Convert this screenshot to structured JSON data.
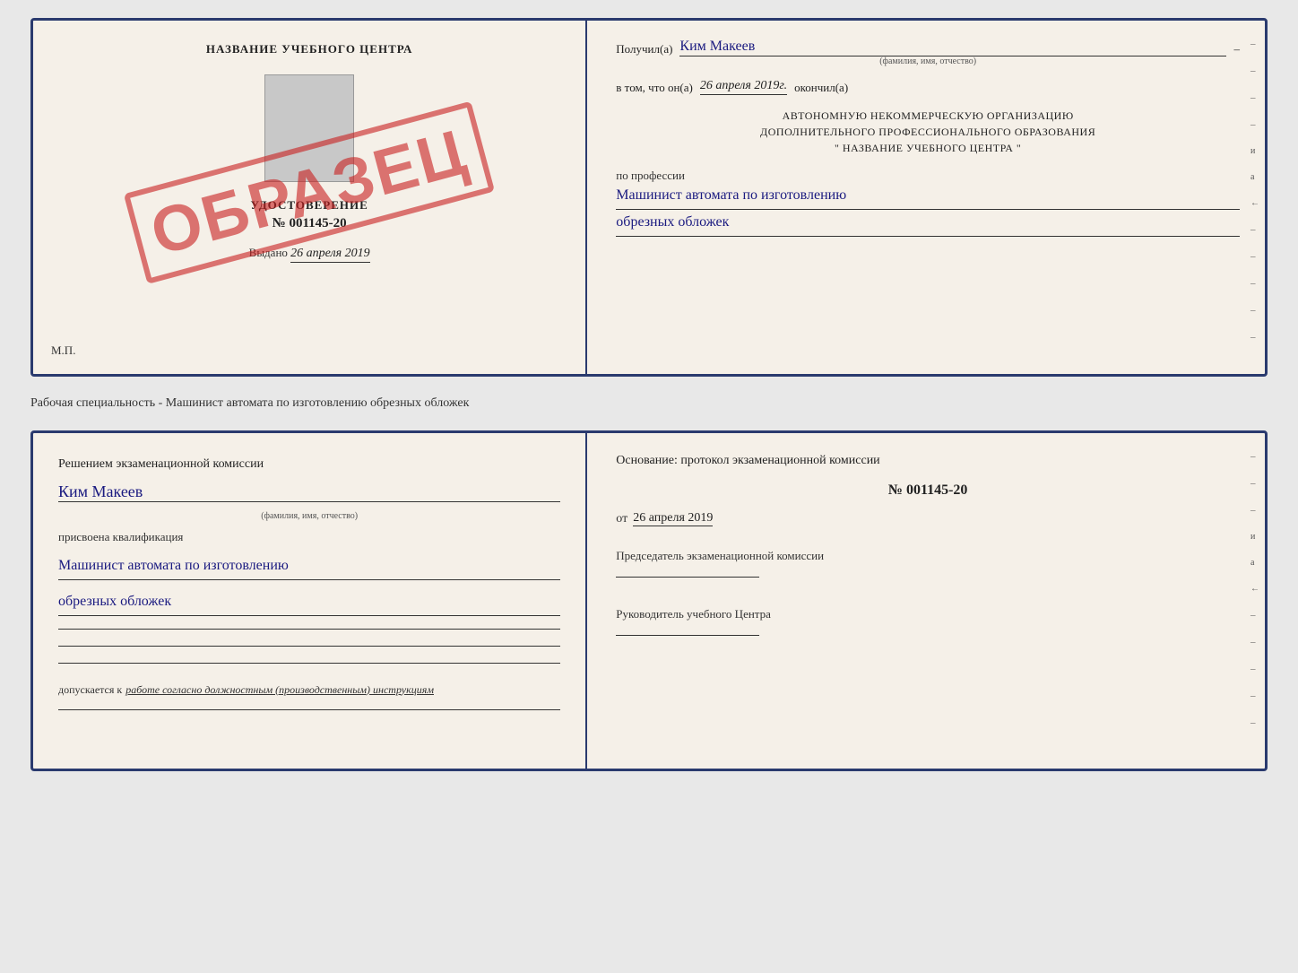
{
  "certificate": {
    "left": {
      "title": "НАЗВАНИЕ УЧЕБНОГО ЦЕНТРА",
      "stamp_text": "ОБРАЗЕЦ",
      "udost_label": "УДОСТОВЕРЕНИЕ",
      "cert_number": "№ 001145-20",
      "issued_label": "Выдано",
      "issued_date": "26 апреля 2019",
      "mp_label": "М.П."
    },
    "right": {
      "received_label": "Получил(а)",
      "received_name": "Ким Макеев",
      "received_subtext": "(фамилия, имя, отчество)",
      "date_label": "в том, что он(а)",
      "date_value": "26 апреля 2019г.",
      "finished_label": "окончил(а)",
      "org_line1": "АВТОНОМНУЮ НЕКОММЕРЧЕСКУЮ ОРГАНИЗАЦИЮ",
      "org_line2": "ДОПОЛНИТЕЛЬНОГО ПРОФЕССИОНАЛЬНОГО ОБРАЗОВАНИЯ",
      "org_line3": "\"  НАЗВАНИЕ УЧЕБНОГО ЦЕНТРА  \"",
      "profession_label": "по профессии",
      "profession_line1": "Машинист автомата по изготовлению",
      "profession_line2": "обрезных обложек",
      "side_dashes": [
        "–",
        "–",
        "–",
        "–",
        "–",
        "–"
      ]
    }
  },
  "separator": {
    "text": "Рабочая специальность - Машинист автомата по изготовлению обрезных обложек"
  },
  "qualification": {
    "left": {
      "decision_label": "Решением экзаменационной комиссии",
      "name": "Ким Макеев",
      "name_subtext": "(фамилия, имя, отчество)",
      "assigned_label": "присвоена квалификация",
      "qualification_line1": "Машинист автомата по изготовлению",
      "qualification_line2": "обрезных обложек",
      "line1": "",
      "line2": "",
      "line3": "",
      "permission_text": "допускается к",
      "permission_italic": "работе согласно должностным (производственным) инструкциям",
      "permission_line": ""
    },
    "right": {
      "basis_label": "Основание: протокол экзаменационной комиссии",
      "protocol_number": "№  001145-20",
      "date_prefix": "от",
      "date_value": "26 апреля 2019",
      "chairman_label": "Председатель экзаменационной комиссии",
      "director_label": "Руководитель учебного Центра",
      "side_dashes": [
        "–",
        "–",
        "–",
        "и",
        "а",
        "←",
        "–",
        "–",
        "–",
        "–",
        "–"
      ]
    }
  }
}
